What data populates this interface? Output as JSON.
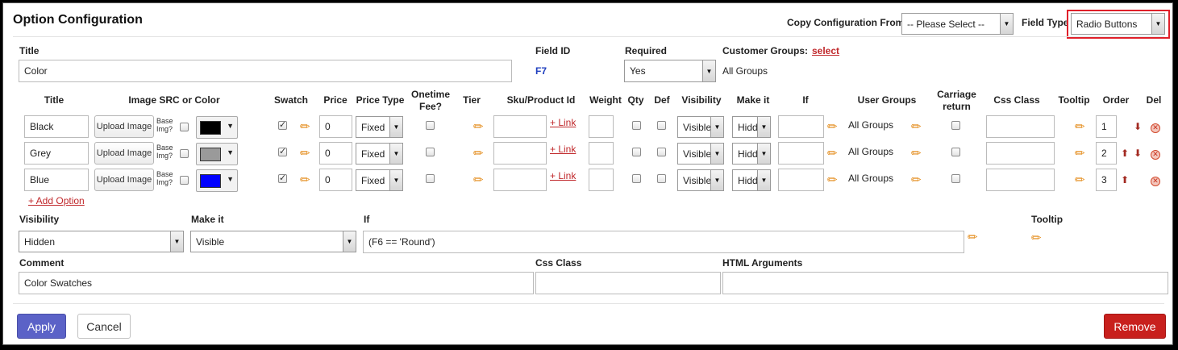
{
  "header": {
    "title": "Option Configuration",
    "copy_label": "Copy Configuration From:",
    "copy_value": "-- Please Select --",
    "field_type_label": "Field Type",
    "field_type_value": "Radio Buttons"
  },
  "general": {
    "title_label": "Title",
    "title_value": "Color",
    "field_id_label": "Field ID",
    "field_id_value": "F7",
    "required_label": "Required",
    "required_value": "Yes",
    "customer_groups_label": "Customer Groups:",
    "customer_groups_link": "select",
    "customer_groups_value": "All Groups"
  },
  "columns": {
    "title": "Title",
    "image": "Image SRC or Color",
    "swatch": "Swatch",
    "price": "Price",
    "price_type": "Price Type",
    "onetime1": "Onetime",
    "onetime2": "Fee?",
    "tier": "Tier",
    "sku": "Sku/Product Id",
    "weight": "Weight",
    "qty": "Qty",
    "def": "Def",
    "visibility": "Visibility",
    "make_it": "Make it",
    "if": "If",
    "user_groups": "User Groups",
    "carriage1": "Carriage",
    "carriage2": "return",
    "css_class": "Css Class",
    "tooltip": "Tooltip",
    "order": "Order",
    "del": "Del"
  },
  "options": [
    {
      "title": "Black",
      "upload": "Upload Image",
      "base1": "Base",
      "base2": "Img?",
      "color": "#000000",
      "price": "0",
      "price_type": "Fixed",
      "link": "+ Link",
      "visibility": "Visible",
      "make_it": "Hidd",
      "user_groups": "All Groups",
      "order": "1"
    },
    {
      "title": "Grey",
      "upload": "Upload Image",
      "base1": "Base",
      "base2": "Img?",
      "color": "#9a9a9a",
      "price": "0",
      "price_type": "Fixed",
      "link": "+ Link",
      "visibility": "Visible",
      "make_it": "Hidd",
      "user_groups": "All Groups",
      "order": "2"
    },
    {
      "title": "Blue",
      "upload": "Upload Image",
      "base1": "Base",
      "base2": "Img?",
      "color": "#0000ff",
      "price": "0",
      "price_type": "Fixed",
      "link": "+ Link",
      "visibility": "Visible",
      "make_it": "Hidd",
      "user_groups": "All Groups",
      "order": "3"
    }
  ],
  "add_option": "+ Add Option",
  "logic": {
    "visibility_label": "Visibility",
    "visibility_value": "Hidden",
    "make_it_label": "Make it",
    "make_it_value": "Visible",
    "if_label": "If",
    "if_value": "(F6 == 'Round')",
    "tooltip_label": "Tooltip"
  },
  "extra": {
    "comment_label": "Comment",
    "comment_value": "Color Swatches",
    "css_label": "Css Class",
    "html_label": "HTML Arguments"
  },
  "footer": {
    "apply": "Apply",
    "cancel": "Cancel",
    "remove": "Remove"
  },
  "colors": {
    "apply_bg": "#5b62c7",
    "remove_bg": "#c8201d",
    "highlight": "#e0202a",
    "link": "#c0282b",
    "field_id": "#1f3fbf"
  },
  "icons": {
    "edit": "pencil-icon",
    "delete": "delete-icon",
    "move_up": "arrow-up-icon",
    "move_down": "arrow-down-icon",
    "dropdown": "chevron-down-icon"
  }
}
